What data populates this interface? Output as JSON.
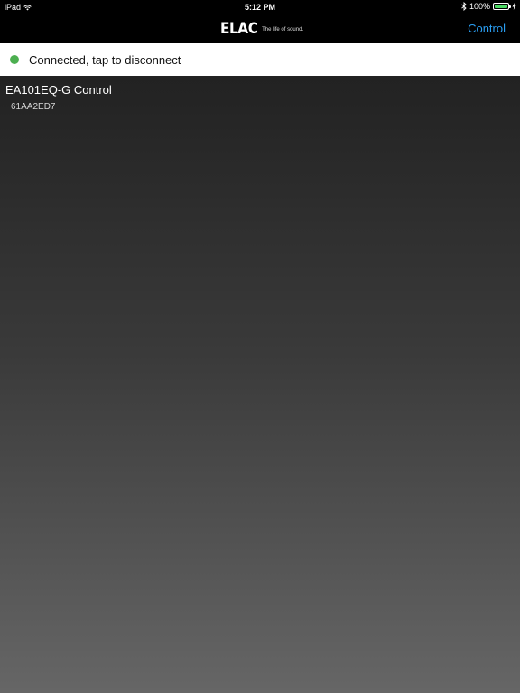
{
  "status_bar": {
    "device": "iPad",
    "wifi_icon": "wifi-icon",
    "time": "5:12 PM",
    "bluetooth_icon": "bluetooth-icon",
    "battery_percent": "100%",
    "battery_level": 1.0,
    "battery_color": "#4cd964"
  },
  "nav": {
    "logo_text": "ELAC",
    "logo_tagline": "The life of sound.",
    "control_label": "Control",
    "control_color": "#2a9ef2"
  },
  "connection": {
    "status_text": "Connected, tap to disconnect",
    "indicator_color": "#4caf50"
  },
  "devices": [
    {
      "name": "EA101EQ-G Control",
      "id": "61AA2ED7"
    }
  ]
}
